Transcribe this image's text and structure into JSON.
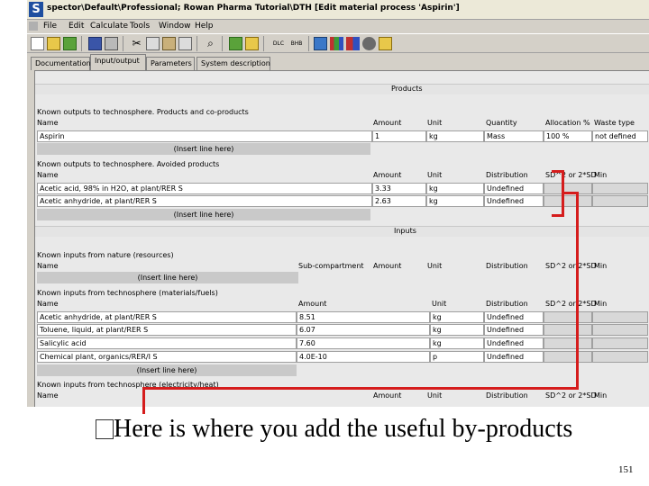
{
  "window": {
    "title": "spector\\Default\\Professional; Rowan Pharma Tutorial\\DTH   [Edit material process 'Aspirin']"
  },
  "menu": [
    "File",
    "Edit",
    "Calculate",
    "Tools",
    "Window",
    "Help"
  ],
  "toolbar_labels": {
    "b1": "DLC",
    "b2": "BHB"
  },
  "tabs": [
    "Documentation",
    "Input/output",
    "Parameters",
    "System description"
  ],
  "products": {
    "header": "Products",
    "known_outputs_title": "Known outputs to technosphere. Products and co-products",
    "columns": [
      "Name",
      "Amount",
      "Unit",
      "Quantity",
      "Allocation %",
      "Waste type"
    ],
    "rows": [
      {
        "name": "Aspirin",
        "amount": "1",
        "unit": "kg",
        "quantity": "Mass",
        "allocation": "100 %",
        "waste": "not defined"
      }
    ],
    "insert_label": "(Insert line here)",
    "avoided_title": "Known outputs to technosphere. Avoided products",
    "avoided_columns": [
      "Name",
      "Amount",
      "Unit",
      "Distribution",
      "SD^2 or 2*SD",
      "Min"
    ],
    "avoided_rows": [
      {
        "name": "Acetic acid, 98% in H2O, at plant/RER S",
        "amount": "3.33",
        "unit": "kg",
        "dist": "Undefined"
      },
      {
        "name": "Acetic anhydride, at plant/RER S",
        "amount": "2.63",
        "unit": "kg",
        "dist": "Undefined"
      }
    ],
    "avoided_insert": "(Insert line here)"
  },
  "inputs": {
    "header": "Inputs",
    "nature_title": "Known inputs from nature (resources)",
    "nature_columns": [
      "Name",
      "Sub-compartment",
      "Amount",
      "Unit",
      "Distribution",
      "SD^2 or 2*SD",
      "Min"
    ],
    "nature_insert": "(Insert line here)",
    "techno_title": "Known inputs from technosphere (materials/fuels)",
    "techno_columns": [
      "Name",
      "Amount",
      "Unit",
      "Distribution",
      "SD^2 or 2*SD",
      "Min"
    ],
    "techno_rows": [
      {
        "name": "Acetic anhydride, at plant/RER S",
        "amount": "8.51",
        "unit": "kg",
        "dist": "Undefined"
      },
      {
        "name": "Toluene, liquid, at plant/RER S",
        "amount": "6.07",
        "unit": "kg",
        "dist": "Undefined"
      },
      {
        "name": "Salicylic acid",
        "amount": "7.60",
        "unit": "kg",
        "dist": "Undefined"
      },
      {
        "name": "Chemical plant, organics/RER/I S",
        "amount": "4.0E-10",
        "unit": "p",
        "dist": "Undefined"
      }
    ],
    "techno_insert": "(Insert line here)",
    "elec_title": "Known inputs from technosphere (electricity/heat)",
    "elec_columns": [
      "Name",
      "Amount",
      "Unit",
      "Distribution",
      "SD^2 or 2*SD",
      "Min"
    ]
  },
  "slide": {
    "bullet": "□",
    "caption": "Here is where you add the useful by-products",
    "page_number": "151"
  },
  "colors": {
    "annotation": "#d51c1c"
  }
}
